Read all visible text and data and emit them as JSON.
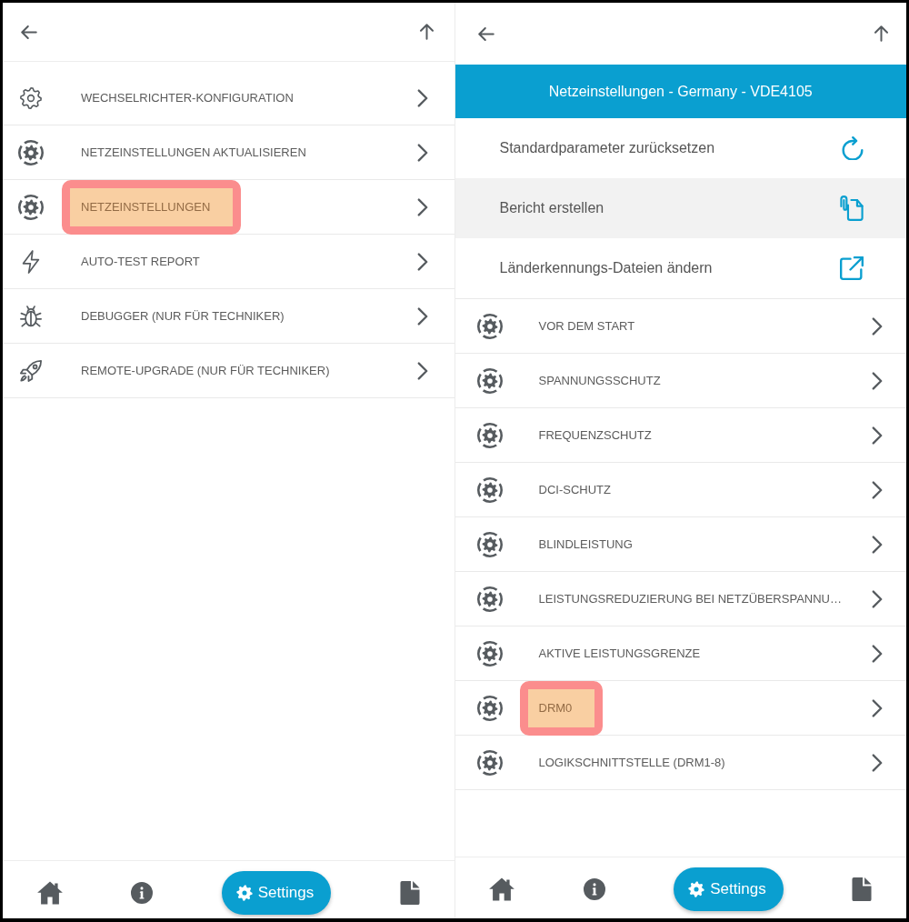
{
  "panels": [
    {
      "menu_items": [
        {
          "label": "WECHSELRICHTER-KONFIGURATION",
          "kind": "gear",
          "highlighted": false
        },
        {
          "label": "NETZEINSTELLUNGEN AKTUALISIEREN",
          "kind": "ringgear",
          "highlighted": false
        },
        {
          "label": "NETZEINSTELLUNGEN",
          "kind": "ringgear",
          "highlighted": true
        },
        {
          "label": "AUTO-TEST REPORT",
          "kind": "bolt",
          "highlighted": false
        },
        {
          "label": "DEBUGGER (NUR FÜR TECHNIKER)",
          "kind": "bug",
          "highlighted": false
        },
        {
          "label": "REMOTE-UPGRADE (NUR FÜR TECHNIKER)",
          "kind": "rocket",
          "highlighted": false
        }
      ],
      "bottom_nav": [
        {
          "kind": "home",
          "selected": false
        },
        {
          "kind": "info",
          "selected": false
        },
        {
          "kind": "settings",
          "label": "Settings",
          "selected": true
        },
        {
          "kind": "document",
          "selected": false
        }
      ]
    },
    {
      "banner": {
        "title": "Netzeinstellungen - Germany - VDE4105"
      },
      "actions": [
        {
          "label": "Standardparameter zurücksetzen",
          "kind": "reset",
          "selected": false
        },
        {
          "label": "Bericht erstellen",
          "kind": "report",
          "selected": true
        },
        {
          "label": "Länderkennungs-Dateien ändern",
          "kind": "external",
          "selected": false
        }
      ],
      "menu_items": [
        {
          "label": "VOR DEM START",
          "kind": "ringgear",
          "highlighted": false
        },
        {
          "label": "SPANNUNGSSCHUTZ",
          "kind": "ringgear",
          "highlighted": false
        },
        {
          "label": "FREQUENZSCHUTZ",
          "kind": "ringgear",
          "highlighted": false
        },
        {
          "label": "DCI-SCHUTZ",
          "kind": "ringgear",
          "highlighted": false
        },
        {
          "label": "BLINDLEISTUNG",
          "kind": "ringgear",
          "highlighted": false
        },
        {
          "label": "LEISTUNGSREDUZIERUNG BEI NETZÜBERSPANNU…",
          "kind": "ringgear",
          "highlighted": false
        },
        {
          "label": "AKTIVE LEISTUNGSGRENZE",
          "kind": "ringgear",
          "highlighted": false
        },
        {
          "label": "DRM0",
          "kind": "ringgear",
          "highlighted": true
        },
        {
          "label": "LOGIKSCHNITTSTELLE (DRM1-8)",
          "kind": "ringgear",
          "highlighted": false
        }
      ],
      "bottom_nav": [
        {
          "kind": "home",
          "selected": false
        },
        {
          "kind": "info",
          "selected": false
        },
        {
          "kind": "settings",
          "label": "Settings",
          "selected": true
        },
        {
          "kind": "document",
          "selected": false
        }
      ]
    }
  ]
}
